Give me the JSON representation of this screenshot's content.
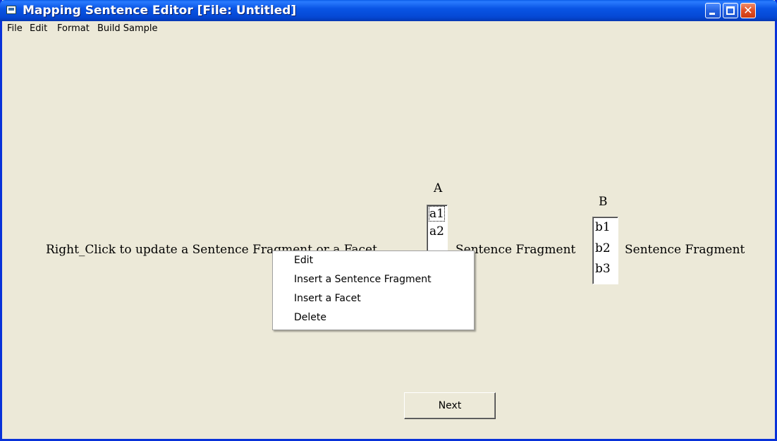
{
  "window": {
    "title": "Mapping Sentence Editor [File: Untitled]",
    "controls": {
      "minimize": "",
      "maximize": "",
      "close": "✕"
    }
  },
  "menu": [
    "File",
    "Edit",
    "Format",
    "Build Sample"
  ],
  "sentence": {
    "fragment_1": "Right_Click to update a Sentence Fragment or a Facet",
    "fragment_2": "Sentence Fragment",
    "fragment_3": "Sentence Fragment"
  },
  "facets": [
    {
      "label": "A",
      "items": [
        "a1",
        "a2"
      ]
    },
    {
      "label": "B",
      "items": [
        "b1",
        "b2",
        "b3"
      ]
    }
  ],
  "context_menu": [
    "Edit",
    "Insert a Sentence Fragment",
    "Insert a Facet",
    "Delete"
  ],
  "next_button": "Next"
}
